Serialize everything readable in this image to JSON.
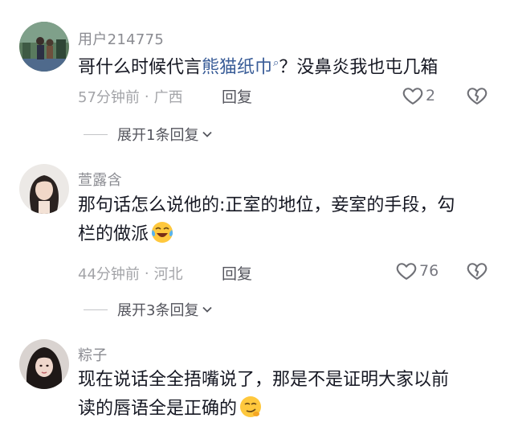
{
  "comments": [
    {
      "username": "用户214775",
      "content_before": "哥什么时候代言",
      "content_link": "熊猫纸巾",
      "content_after": "？没鼻炎我也屯几箱",
      "time": "57分钟前",
      "location": "广西",
      "reply_label": "回复",
      "like_count": "2",
      "expand_label": "展开1条回复"
    },
    {
      "username": "萱露含",
      "content_line1": "那句话怎么说他的:正室的地位，妾室的手段，勾",
      "content_line2": "栏的做派",
      "emoji": "laughing-crying-emoji",
      "time": "44分钟前",
      "location": "河北",
      "reply_label": "回复",
      "like_count": "76",
      "expand_label": "展开3条回复"
    },
    {
      "username": "粽子",
      "content_line1": "现在说话全全捂嘴说了，那是不是证明大家以前",
      "content_line2": "读的唇语全是正确的",
      "emoji": "smirk-emoji"
    }
  ],
  "icons": {
    "like": "heart-outline-icon",
    "dislike": "broken-heart-icon",
    "expand": "chevron-down-icon",
    "search": "search-icon"
  },
  "colors": {
    "text_primary": "#161823",
    "text_secondary": "#8a8b91",
    "link": "#3a5d98"
  }
}
